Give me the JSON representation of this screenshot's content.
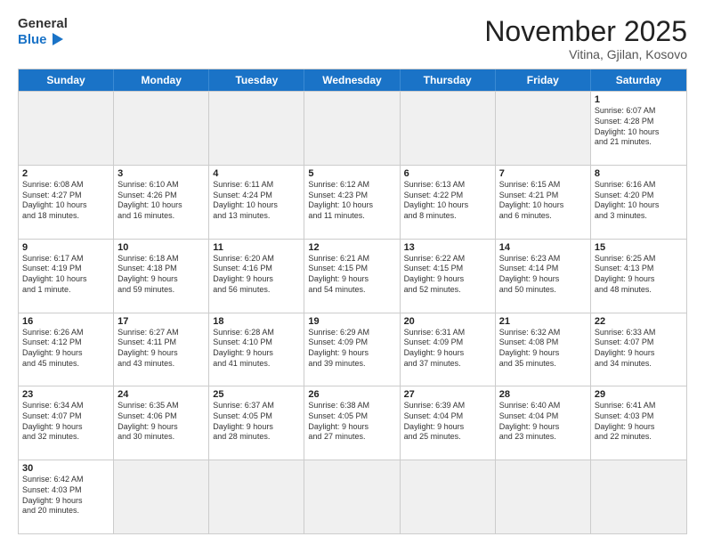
{
  "header": {
    "logo_general": "General",
    "logo_blue": "Blue",
    "title": "November 2025",
    "subtitle": "Vitina, Gjilan, Kosovo"
  },
  "weekdays": [
    "Sunday",
    "Monday",
    "Tuesday",
    "Wednesday",
    "Thursday",
    "Friday",
    "Saturday"
  ],
  "weeks": [
    [
      {
        "day": "",
        "info": "",
        "shaded": true
      },
      {
        "day": "",
        "info": "",
        "shaded": true
      },
      {
        "day": "",
        "info": "",
        "shaded": true
      },
      {
        "day": "",
        "info": "",
        "shaded": true
      },
      {
        "day": "",
        "info": "",
        "shaded": true
      },
      {
        "day": "",
        "info": "",
        "shaded": true
      },
      {
        "day": "1",
        "info": "Sunrise: 6:07 AM\nSunset: 4:28 PM\nDaylight: 10 hours\nand 21 minutes.",
        "shaded": false
      }
    ],
    [
      {
        "day": "2",
        "info": "Sunrise: 6:08 AM\nSunset: 4:27 PM\nDaylight: 10 hours\nand 18 minutes.",
        "shaded": false
      },
      {
        "day": "3",
        "info": "Sunrise: 6:10 AM\nSunset: 4:26 PM\nDaylight: 10 hours\nand 16 minutes.",
        "shaded": false
      },
      {
        "day": "4",
        "info": "Sunrise: 6:11 AM\nSunset: 4:24 PM\nDaylight: 10 hours\nand 13 minutes.",
        "shaded": false
      },
      {
        "day": "5",
        "info": "Sunrise: 6:12 AM\nSunset: 4:23 PM\nDaylight: 10 hours\nand 11 minutes.",
        "shaded": false
      },
      {
        "day": "6",
        "info": "Sunrise: 6:13 AM\nSunset: 4:22 PM\nDaylight: 10 hours\nand 8 minutes.",
        "shaded": false
      },
      {
        "day": "7",
        "info": "Sunrise: 6:15 AM\nSunset: 4:21 PM\nDaylight: 10 hours\nand 6 minutes.",
        "shaded": false
      },
      {
        "day": "8",
        "info": "Sunrise: 6:16 AM\nSunset: 4:20 PM\nDaylight: 10 hours\nand 3 minutes.",
        "shaded": false
      }
    ],
    [
      {
        "day": "9",
        "info": "Sunrise: 6:17 AM\nSunset: 4:19 PM\nDaylight: 10 hours\nand 1 minute.",
        "shaded": false
      },
      {
        "day": "10",
        "info": "Sunrise: 6:18 AM\nSunset: 4:18 PM\nDaylight: 9 hours\nand 59 minutes.",
        "shaded": false
      },
      {
        "day": "11",
        "info": "Sunrise: 6:20 AM\nSunset: 4:16 PM\nDaylight: 9 hours\nand 56 minutes.",
        "shaded": false
      },
      {
        "day": "12",
        "info": "Sunrise: 6:21 AM\nSunset: 4:15 PM\nDaylight: 9 hours\nand 54 minutes.",
        "shaded": false
      },
      {
        "day": "13",
        "info": "Sunrise: 6:22 AM\nSunset: 4:15 PM\nDaylight: 9 hours\nand 52 minutes.",
        "shaded": false
      },
      {
        "day": "14",
        "info": "Sunrise: 6:23 AM\nSunset: 4:14 PM\nDaylight: 9 hours\nand 50 minutes.",
        "shaded": false
      },
      {
        "day": "15",
        "info": "Sunrise: 6:25 AM\nSunset: 4:13 PM\nDaylight: 9 hours\nand 48 minutes.",
        "shaded": false
      }
    ],
    [
      {
        "day": "16",
        "info": "Sunrise: 6:26 AM\nSunset: 4:12 PM\nDaylight: 9 hours\nand 45 minutes.",
        "shaded": false
      },
      {
        "day": "17",
        "info": "Sunrise: 6:27 AM\nSunset: 4:11 PM\nDaylight: 9 hours\nand 43 minutes.",
        "shaded": false
      },
      {
        "day": "18",
        "info": "Sunrise: 6:28 AM\nSunset: 4:10 PM\nDaylight: 9 hours\nand 41 minutes.",
        "shaded": false
      },
      {
        "day": "19",
        "info": "Sunrise: 6:29 AM\nSunset: 4:09 PM\nDaylight: 9 hours\nand 39 minutes.",
        "shaded": false
      },
      {
        "day": "20",
        "info": "Sunrise: 6:31 AM\nSunset: 4:09 PM\nDaylight: 9 hours\nand 37 minutes.",
        "shaded": false
      },
      {
        "day": "21",
        "info": "Sunrise: 6:32 AM\nSunset: 4:08 PM\nDaylight: 9 hours\nand 35 minutes.",
        "shaded": false
      },
      {
        "day": "22",
        "info": "Sunrise: 6:33 AM\nSunset: 4:07 PM\nDaylight: 9 hours\nand 34 minutes.",
        "shaded": false
      }
    ],
    [
      {
        "day": "23",
        "info": "Sunrise: 6:34 AM\nSunset: 4:07 PM\nDaylight: 9 hours\nand 32 minutes.",
        "shaded": false
      },
      {
        "day": "24",
        "info": "Sunrise: 6:35 AM\nSunset: 4:06 PM\nDaylight: 9 hours\nand 30 minutes.",
        "shaded": false
      },
      {
        "day": "25",
        "info": "Sunrise: 6:37 AM\nSunset: 4:05 PM\nDaylight: 9 hours\nand 28 minutes.",
        "shaded": false
      },
      {
        "day": "26",
        "info": "Sunrise: 6:38 AM\nSunset: 4:05 PM\nDaylight: 9 hours\nand 27 minutes.",
        "shaded": false
      },
      {
        "day": "27",
        "info": "Sunrise: 6:39 AM\nSunset: 4:04 PM\nDaylight: 9 hours\nand 25 minutes.",
        "shaded": false
      },
      {
        "day": "28",
        "info": "Sunrise: 6:40 AM\nSunset: 4:04 PM\nDaylight: 9 hours\nand 23 minutes.",
        "shaded": false
      },
      {
        "day": "29",
        "info": "Sunrise: 6:41 AM\nSunset: 4:03 PM\nDaylight: 9 hours\nand 22 minutes.",
        "shaded": false
      }
    ],
    [
      {
        "day": "30",
        "info": "Sunrise: 6:42 AM\nSunset: 4:03 PM\nDaylight: 9 hours\nand 20 minutes.",
        "shaded": false
      },
      {
        "day": "",
        "info": "",
        "shaded": true
      },
      {
        "day": "",
        "info": "",
        "shaded": true
      },
      {
        "day": "",
        "info": "",
        "shaded": true
      },
      {
        "day": "",
        "info": "",
        "shaded": true
      },
      {
        "day": "",
        "info": "",
        "shaded": true
      },
      {
        "day": "",
        "info": "",
        "shaded": true
      }
    ]
  ]
}
